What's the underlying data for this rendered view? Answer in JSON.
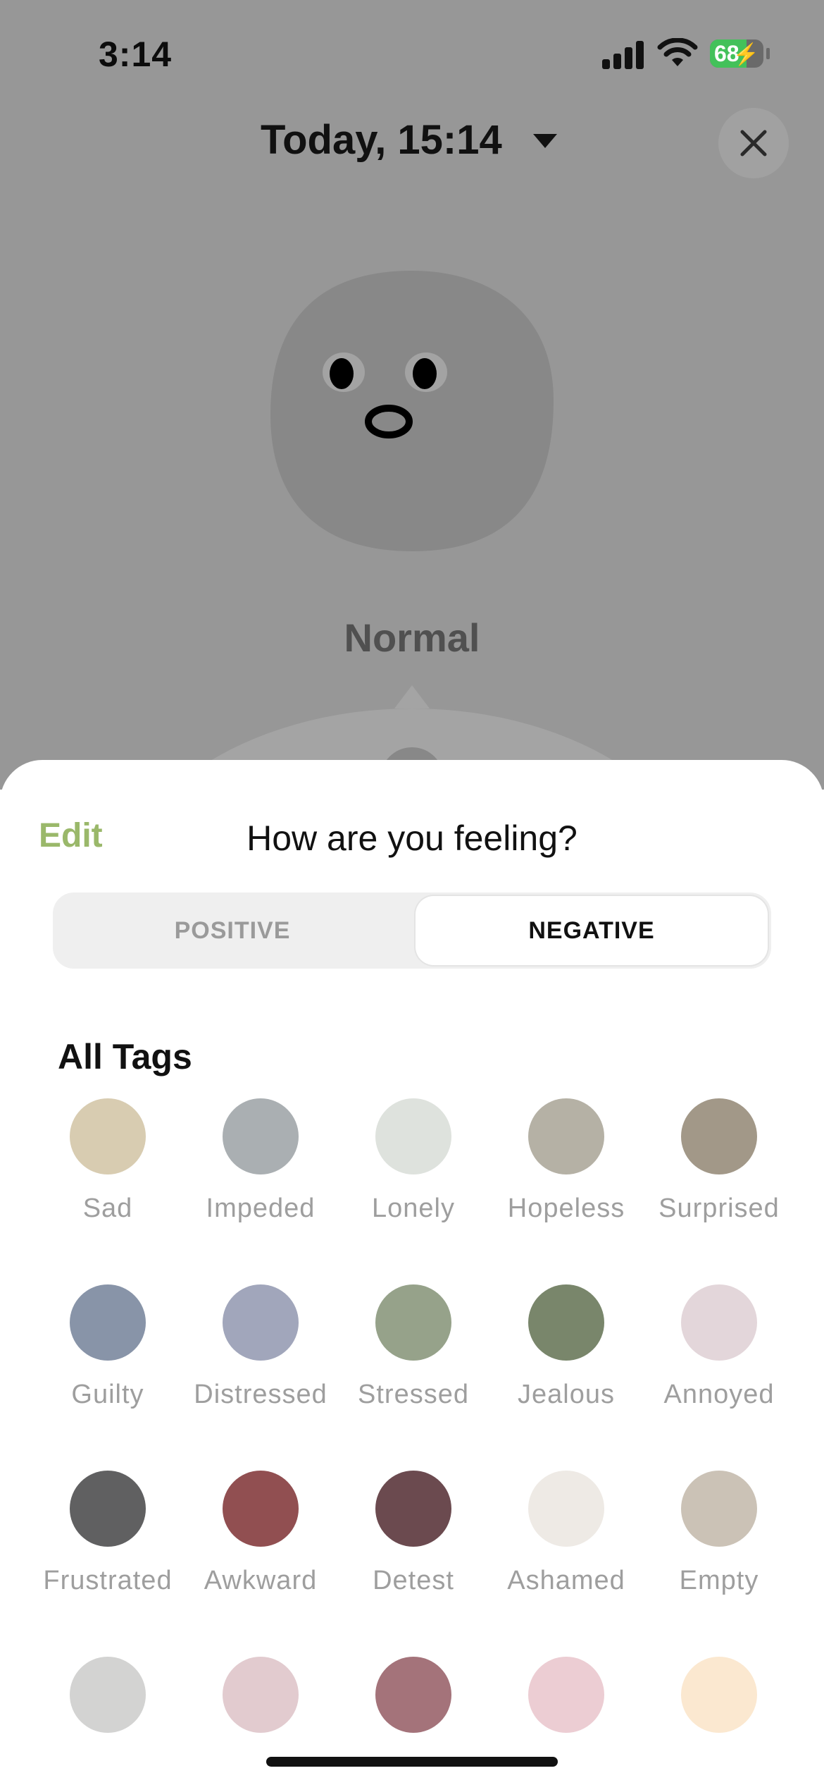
{
  "status_bar": {
    "time": "3:14",
    "battery": "68"
  },
  "header": {
    "date": "Today, 15:14"
  },
  "mood": {
    "label": "Normal"
  },
  "sheet": {
    "edit_label": "Edit",
    "question": "How are you feeling?",
    "segments": {
      "positive": "POSITIVE",
      "negative": "NEGATIVE",
      "selected": "NEGATIVE"
    },
    "section_title": "All Tags",
    "tags": [
      {
        "label": "Sad",
        "color": "#D8CCB1"
      },
      {
        "label": "Impeded",
        "color": "#AAAFB2"
      },
      {
        "label": "Lonely",
        "color": "#DEE2DD"
      },
      {
        "label": "Hopeless",
        "color": "#B5B1A5"
      },
      {
        "label": "Surprised",
        "color": "#A29888"
      },
      {
        "label": "Guilty",
        "color": "#8894A8"
      },
      {
        "label": "Distressed",
        "color": "#A1A6BB"
      },
      {
        "label": "Stressed",
        "color": "#96A28A"
      },
      {
        "label": "Jealous",
        "color": "#79866B"
      },
      {
        "label": "Annoyed",
        "color": "#E3D6DA"
      },
      {
        "label": "Frustrated",
        "color": "#606061"
      },
      {
        "label": "Awkward",
        "color": "#914F51"
      },
      {
        "label": "Detest",
        "color": "#6B4A4F"
      },
      {
        "label": "Ashamed",
        "color": "#EEEAE5"
      },
      {
        "label": "Empty",
        "color": "#CBC2B6"
      },
      {
        "label": "",
        "color": "#D3D3D2"
      },
      {
        "label": "",
        "color": "#E2CBCF"
      },
      {
        "label": "",
        "color": "#A4737A"
      },
      {
        "label": "",
        "color": "#ECCDD3"
      },
      {
        "label": "",
        "color": "#FBE8D0"
      }
    ]
  },
  "icons": {
    "signal": "cellular-signal-icon",
    "wifi": "wifi-icon",
    "battery": "battery-charging-icon",
    "dropdown": "caret-down-icon",
    "close": "close-icon",
    "face": "mood-face-icon"
  }
}
